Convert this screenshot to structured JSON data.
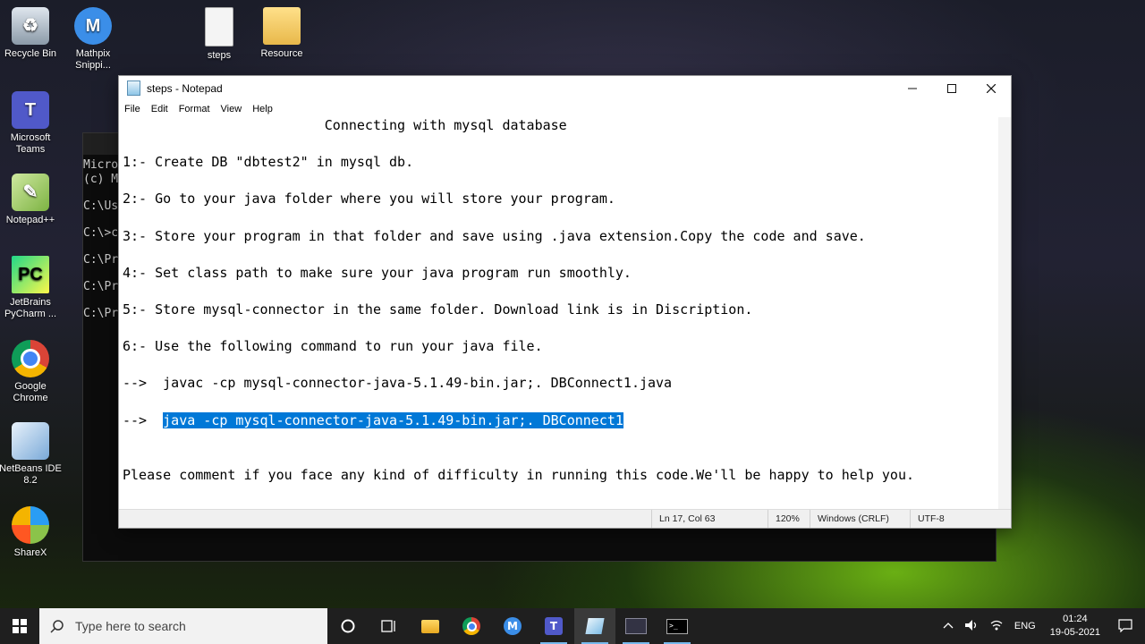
{
  "desktop": {
    "icons": [
      {
        "label": "Recycle Bin",
        "icon": "recycle-bin-icon"
      },
      {
        "label": "Mathpix Snippi...",
        "icon": "mathpix-icon"
      },
      {
        "label": "steps",
        "icon": "text-file-icon"
      },
      {
        "label": "Resource",
        "icon": "folder-icon"
      },
      {
        "label": "Microsoft Teams",
        "icon": "teams-icon"
      },
      {
        "label": "Notepad++",
        "icon": "notepadpp-icon"
      },
      {
        "label": "JetBrains PyCharm ...",
        "icon": "pycharm-icon"
      },
      {
        "label": "Google Chrome",
        "icon": "chrome-icon"
      },
      {
        "label": "NetBeans IDE 8.2",
        "icon": "netbeans-icon"
      },
      {
        "label": "ShareX",
        "icon": "sharex-icon"
      }
    ]
  },
  "console": {
    "lines": [
      "Micro",
      "(c) M",
      "C:\\Us",
      "C:\\>c",
      "C:\\Pr",
      "C:\\Pr",
      "C:\\Pr"
    ]
  },
  "notepad": {
    "title": "steps - Notepad",
    "menu": [
      "File",
      "Edit",
      "Format",
      "View",
      "Help"
    ],
    "lines": [
      "                         Connecting with mysql database",
      "1:- Create DB \"dbtest2\" in mysql db.",
      "2:- Go to your java folder where you will store your program.",
      "3:- Store your program in that folder and save using .java extension.Copy the code and save.",
      "4:- Set class path to make sure your java program run smoothly.",
      "5:- Store mysql-connector in the same folder. Download link is in Discription.",
      "6:- Use the following command to run your java file.",
      "-->  javac -cp mysql-connector-java-5.1.49-bin.jar;. DBConnect1.java",
      "Please comment if you face any kind of difficulty in running this code.We'll be happy to help you."
    ],
    "selected_line_prefix": "-->  ",
    "selected_text": "java -cp mysql-connector-java-5.1.49-bin.jar;. DBConnect1",
    "status": {
      "position": "Ln 17, Col 63",
      "zoom": "120%",
      "line_ending": "Windows (CRLF)",
      "encoding": "UTF-8"
    }
  },
  "taskbar": {
    "search_placeholder": "Type here to search",
    "language": "ENG",
    "time": "01:24",
    "date": "19-05-2021"
  }
}
